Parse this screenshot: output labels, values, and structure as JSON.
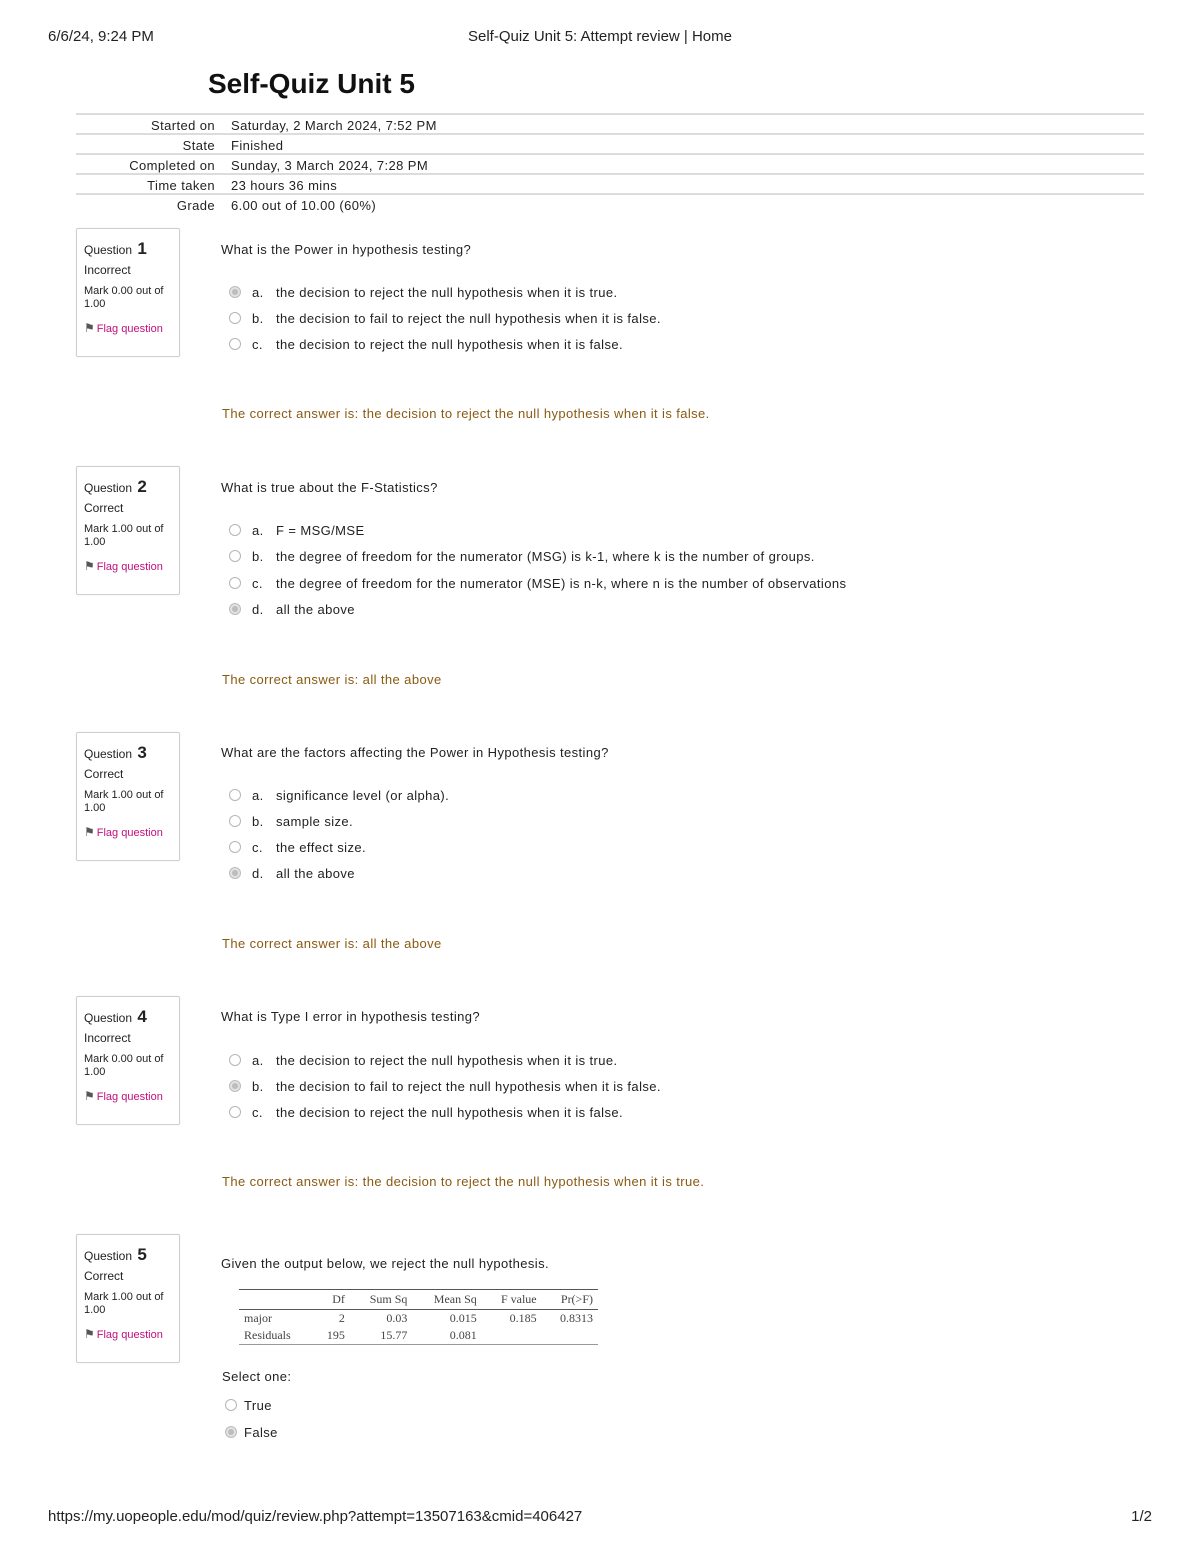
{
  "print_header": {
    "datetime": "6/6/24, 9:24 PM",
    "title": "Self-Quiz Unit 5: Attempt review | Home"
  },
  "print_footer": {
    "url": "https://my.uopeople.edu/mod/quiz/review.php?attempt=13507163&cmid=406427",
    "page": "1/2"
  },
  "quiz_title": "Self-Quiz Unit 5",
  "summary": [
    {
      "label": "Started on",
      "value": "Saturday, 2 March 2024, 7:52 PM"
    },
    {
      "label": "State",
      "value": "Finished"
    },
    {
      "label": "Completed on",
      "value": "Sunday, 3 March 2024, 7:28 PM"
    },
    {
      "label": "Time taken",
      "value": "23 hours 36 mins"
    },
    {
      "label": "Grade",
      "value": "6.00 out of 10.00 (60%)"
    }
  ],
  "flag_label": "Flag question",
  "question_label": "Question",
  "questions": [
    {
      "number": "1",
      "state": "Incorrect",
      "mark": "Mark 0.00 out of 1.00",
      "text": "What is the Power in hypothesis testing?",
      "options": [
        {
          "letter": "a.",
          "text": "the decision to reject the null hypothesis when it is true.",
          "selected": true
        },
        {
          "letter": "b.",
          "text": "the decision to fail to reject the null hypothesis when it is false.",
          "selected": false
        },
        {
          "letter": "c.",
          "text": "the decision to reject the null hypothesis when it is false.",
          "selected": false
        }
      ],
      "feedback": "The correct answer is: the decision to reject the null hypothesis when it is false."
    },
    {
      "number": "2",
      "state": "Correct",
      "mark": "Mark 1.00 out of 1.00",
      "text": "What is true about the F-Statistics?",
      "options": [
        {
          "letter": "a.",
          "text": "F = MSG/MSE",
          "selected": false
        },
        {
          "letter": "b.",
          "text": "the degree of freedom for the numerator (MSG) is k-1, where k is the number of groups.",
          "selected": false
        },
        {
          "letter": "c.",
          "text": "the degree of freedom for the numerator (MSE) is n-k, where n is the number of observations",
          "selected": false
        },
        {
          "letter": "d.",
          "text": "all the above",
          "selected": true
        }
      ],
      "feedback": "The correct answer is: all the above"
    },
    {
      "number": "3",
      "state": "Correct",
      "mark": "Mark 1.00 out of 1.00",
      "text": "What are the factors affecting the Power in Hypothesis testing?",
      "options": [
        {
          "letter": "a.",
          "text": "significance level (or alpha).",
          "selected": false
        },
        {
          "letter": "b.",
          "text": "sample size.",
          "selected": false
        },
        {
          "letter": "c.",
          "text": "the effect size.",
          "selected": false
        },
        {
          "letter": "d.",
          "text": "all the above",
          "selected": true
        }
      ],
      "feedback": "The correct answer is: all the above"
    },
    {
      "number": "4",
      "state": "Incorrect",
      "mark": "Mark 0.00 out of 1.00",
      "text": "What is Type I error in hypothesis testing?",
      "options": [
        {
          "letter": "a.",
          "text": "the decision to reject the null hypothesis when it is true.",
          "selected": false
        },
        {
          "letter": "b.",
          "text": "the decision to fail to reject the null hypothesis when it is false.",
          "selected": true
        },
        {
          "letter": "c.",
          "text": "the decision to reject the null hypothesis when it is false.",
          "selected": false
        }
      ],
      "feedback": "The correct answer is: the decision to reject the null hypothesis when it is true."
    },
    {
      "number": "5",
      "state": "Correct",
      "mark": "Mark 1.00 out of 1.00",
      "text": "Given the output below, we reject the null hypothesis.",
      "anova": {
        "headers": [
          "",
          "Df",
          "Sum Sq",
          "Mean Sq",
          "F value",
          "Pr(>F)"
        ],
        "rows": [
          [
            "major",
            "2",
            "0.03",
            "0.015",
            "0.185",
            "0.8313"
          ],
          [
            "Residuals",
            "195",
            "15.77",
            "0.081",
            "",
            ""
          ]
        ]
      },
      "select_one": "Select one:",
      "tf_options": [
        {
          "text": "True",
          "selected": false
        },
        {
          "text": "False",
          "selected": true
        }
      ]
    }
  ]
}
